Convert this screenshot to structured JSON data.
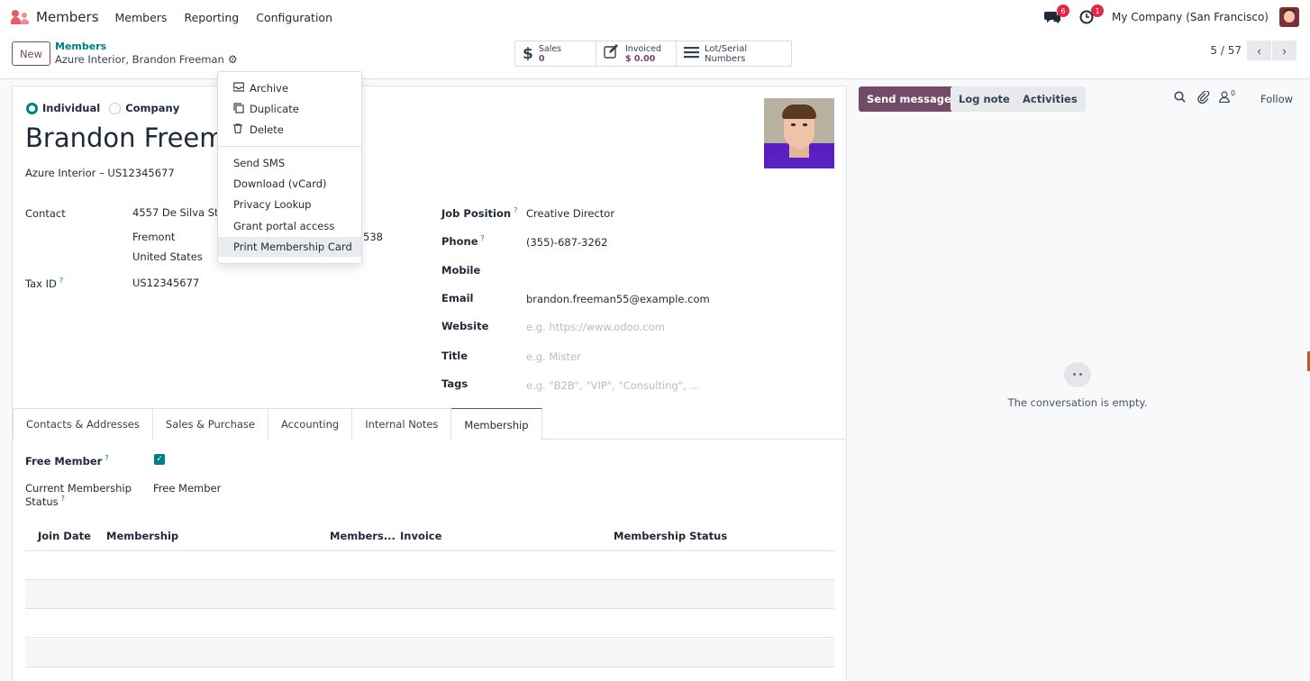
{
  "navbar": {
    "app_name": "Members",
    "menus": [
      "Members",
      "Reporting",
      "Configuration"
    ],
    "messages_badge": "6",
    "activities_badge": "1",
    "company": "My Company (San Francisco)"
  },
  "control": {
    "new_label": "New",
    "breadcrumb_parent": "Members",
    "breadcrumb_current": "Azure Interior, Brandon Freeman",
    "stats": {
      "sales_label": "Sales",
      "sales_value": "0",
      "invoiced_label": "Invoiced",
      "invoiced_value": "$ 0.00",
      "lots_label": "Lot/Serial Numbers"
    },
    "pager": "5 / 57"
  },
  "form": {
    "type_individual": "Individual",
    "type_company": "Company",
    "name": "Brandon Freema",
    "company_line": "Azure Interior – US12345677",
    "contact_label": "Contact",
    "address_street": "4557 De Silva St",
    "address_city": "Fremont",
    "address_zip_tail": "538",
    "address_country": "United States",
    "tax_label": "Tax ID",
    "tax_value": "US12345677",
    "job_label": "Job Position",
    "job_value": "Creative Director",
    "phone_label": "Phone",
    "phone_value": "(355)-687-3262",
    "mobile_label": "Mobile",
    "email_label": "Email",
    "email_value": "brandon.freeman55@example.com",
    "website_label": "Website",
    "website_placeholder": "e.g. https://www.odoo.com",
    "title_label": "Title",
    "title_placeholder": "e.g. Mister",
    "tags_label": "Tags",
    "tags_placeholder": "e.g. \"B2B\", \"VIP\", \"Consulting\", ...",
    "help_mark": "?"
  },
  "tabs": [
    "Contacts & Addresses",
    "Sales & Purchase",
    "Accounting",
    "Internal Notes",
    "Membership"
  ],
  "membership": {
    "free_member_label": "Free Member",
    "free_member_checked": true,
    "status_label_1": "Current Membership",
    "status_label_2": "Status",
    "status_value": "Free Member",
    "columns": [
      "Join Date",
      "Membership",
      "Members...",
      "Invoice",
      "Membership Status"
    ]
  },
  "dropdown": {
    "items": [
      "Archive",
      "Duplicate",
      "Delete"
    ],
    "actions": [
      "Send SMS",
      "Download (vCard)",
      "Privacy Lookup",
      "Grant portal access",
      "Print Membership Card"
    ],
    "hovered": "Print Membership Card"
  },
  "chatter": {
    "send_message": "Send message",
    "log_note": "Log note",
    "activities": "Activities",
    "followers_count": "0",
    "follow": "Follow",
    "empty_text": "The conversation is empty."
  },
  "colors": {
    "brand": "#714b67",
    "accent": "#017e84",
    "badge": "#e0284a"
  }
}
